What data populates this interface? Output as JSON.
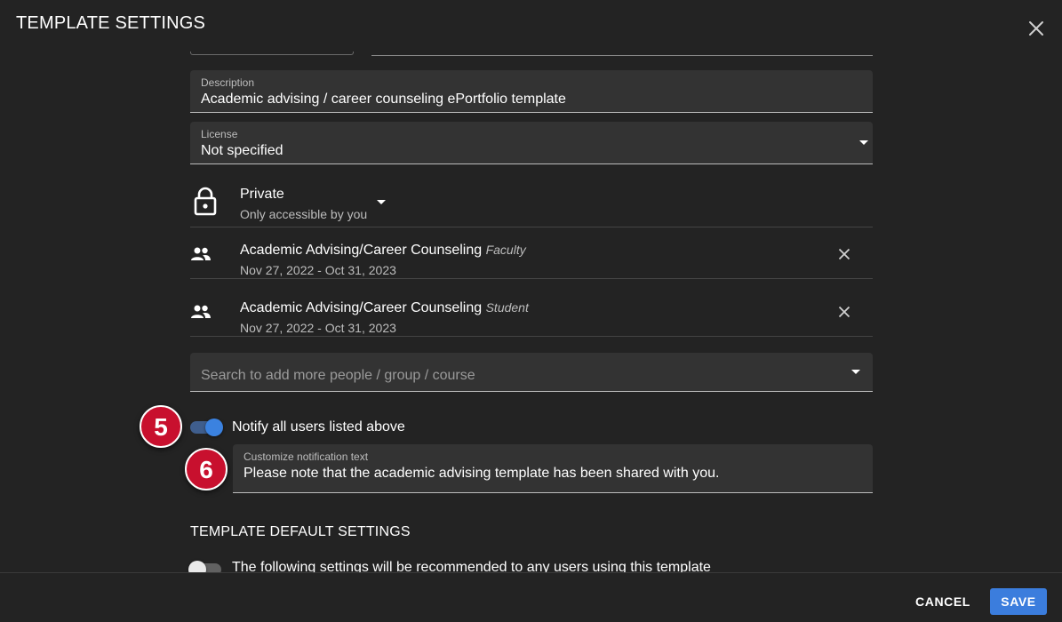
{
  "dialog": {
    "title": "TEMPLATE SETTINGS",
    "close_icon": "close-icon"
  },
  "description": {
    "label": "Description",
    "value": "Academic advising / career counseling ePortfolio template"
  },
  "license": {
    "label": "License",
    "value": "Not specified"
  },
  "privacy": {
    "icon": "lock-icon",
    "title": "Private",
    "subtitle": "Only accessible by you"
  },
  "shares": [
    {
      "icon": "group-icon",
      "name": "Academic Advising/Career Counseling",
      "role": "Faculty",
      "dates": "Nov 27, 2022 - Oct 31, 2023"
    },
    {
      "icon": "group-icon",
      "name": "Academic Advising/Career Counseling",
      "role": "Student",
      "dates": "Nov 27, 2022 - Oct 31, 2023"
    }
  ],
  "search": {
    "placeholder": "Search to add more people / group / course"
  },
  "notify": {
    "label": "Notify all users listed above",
    "enabled": true
  },
  "notification_text": {
    "label": "Customize notification text",
    "value": "Please note that the academic advising template has been shared with you."
  },
  "callouts": [
    "5",
    "6"
  ],
  "defaults_section": {
    "title": "TEMPLATE DEFAULT SETTINGS",
    "recommend_label": "The following settings will be recommended to any users using this template",
    "recommend_enabled": false
  },
  "footer": {
    "cancel_label": "CANCEL",
    "save_label": "SAVE"
  },
  "colors": {
    "background": "#232323",
    "field": "#333333",
    "accent": "#3b7ddd",
    "callout": "#c8102e"
  }
}
